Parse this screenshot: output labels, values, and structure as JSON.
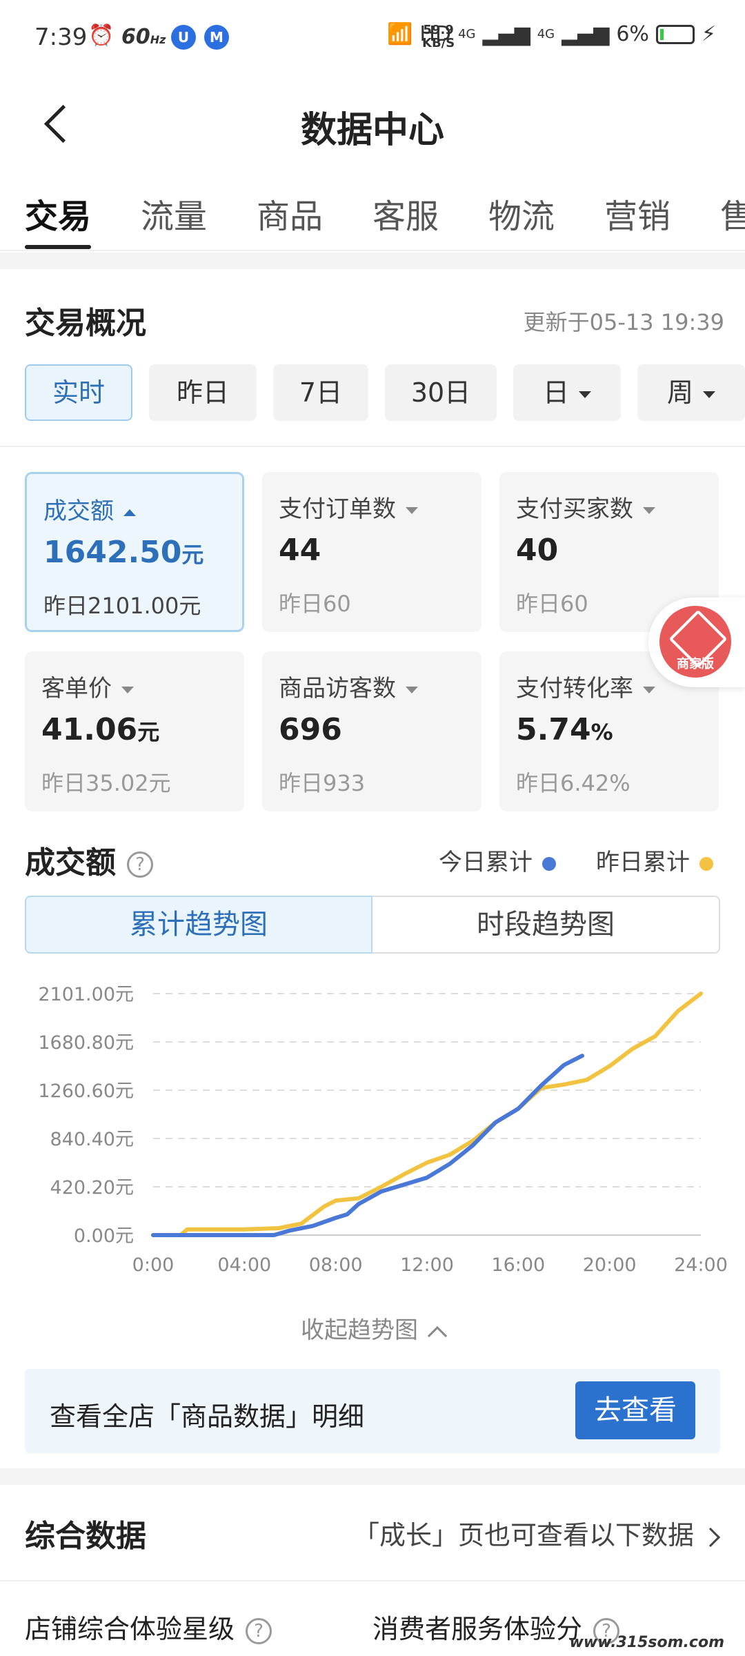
{
  "status_bar": {
    "time": "7:39",
    "refresh": "60",
    "refresh_unit": "Hz",
    "app_icon_1": "U",
    "app_icon_2": "M",
    "net_speed": "59.9",
    "net_speed_unit": "KB/S",
    "hd": "HD",
    "signal_1": "4G",
    "signal_2": "4G",
    "battery": "6%"
  },
  "header": {
    "title": "数据中心"
  },
  "tabs": [
    "交易",
    "流量",
    "商品",
    "客服",
    "物流",
    "营销",
    "售"
  ],
  "overview": {
    "title": "交易概况",
    "updated": "更新于05-13 19:39",
    "ranges": [
      {
        "label": "实时"
      },
      {
        "label": "昨日"
      },
      {
        "label": "7日"
      },
      {
        "label": "30日"
      },
      {
        "label": "日"
      },
      {
        "label": "周"
      }
    ],
    "cards": [
      {
        "label": "成交额",
        "value": "1642.50",
        "unit": "元",
        "sub": "昨日2101.00元"
      },
      {
        "label": "支付订单数",
        "value": "44",
        "unit": "",
        "sub": "昨日60"
      },
      {
        "label": "支付买家数",
        "value": "40",
        "unit": "",
        "sub": "昨日60"
      },
      {
        "label": "客单价",
        "value": "41.06",
        "unit": "元",
        "sub": "昨日35.02元"
      },
      {
        "label": "商品访客数",
        "value": "696",
        "unit": "",
        "sub": "昨日933"
      },
      {
        "label": "支付转化率",
        "value": "5.74",
        "unit": "%",
        "sub": "昨日6.42%"
      }
    ],
    "badge_label": "商家版"
  },
  "trend": {
    "title": "成交额",
    "help": "?",
    "legend_today": "今日累计",
    "legend_yesterday": "昨日累计",
    "seg_cumulative": "累计趋势图",
    "seg_period": "时段趋势图",
    "collapse": "收起趋势图"
  },
  "colors": {
    "today": "#4a78d6",
    "yesterday": "#f2c341",
    "accent": "#2b72cf"
  },
  "chart_data": {
    "type": "line",
    "x_ticks": [
      "0:00",
      "04:00",
      "08:00",
      "12:00",
      "16:00",
      "20:00",
      "24:00"
    ],
    "y_ticks": [
      "0.00元",
      "420.20元",
      "840.40元",
      "1260.60元",
      "1680.80元",
      "2101.00元"
    ],
    "ylim": [
      0,
      2101
    ],
    "xlim": [
      0,
      24
    ],
    "series": [
      {
        "name": "今日累计",
        "color": "#4a78d6",
        "x": [
          0,
          2,
          4,
          5.3,
          6,
          7,
          8,
          8.5,
          9,
          10,
          11,
          12,
          13,
          14,
          14.5,
          15,
          16,
          17,
          18,
          18.8
        ],
        "y": [
          0,
          0,
          0,
          0,
          40,
          80,
          150,
          180,
          270,
          380,
          440,
          500,
          620,
          780,
          880,
          980,
          1100,
          1300,
          1480,
          1560
        ]
      },
      {
        "name": "昨日累计",
        "color": "#f2c341",
        "x": [
          0,
          1.2,
          1.5,
          4,
          5.5,
          6.5,
          7.5,
          8,
          9,
          10,
          11,
          12,
          13,
          14,
          15,
          16,
          17,
          18,
          19,
          20,
          21,
          22,
          23,
          24
        ],
        "y": [
          0,
          0,
          50,
          50,
          60,
          100,
          250,
          300,
          320,
          420,
          530,
          630,
          700,
          820,
          980,
          1100,
          1280,
          1310,
          1350,
          1470,
          1620,
          1730,
          1950,
          2101
        ]
      }
    ]
  },
  "banner": {
    "text": "查看全店「商品数据」明细",
    "button": "去查看"
  },
  "composite": {
    "title": "综合数据",
    "link": "「成长」页也可查看以下数据",
    "items": [
      "店铺综合体验星级",
      "消费者服务体验分"
    ]
  },
  "watermark": "www.315som.com"
}
